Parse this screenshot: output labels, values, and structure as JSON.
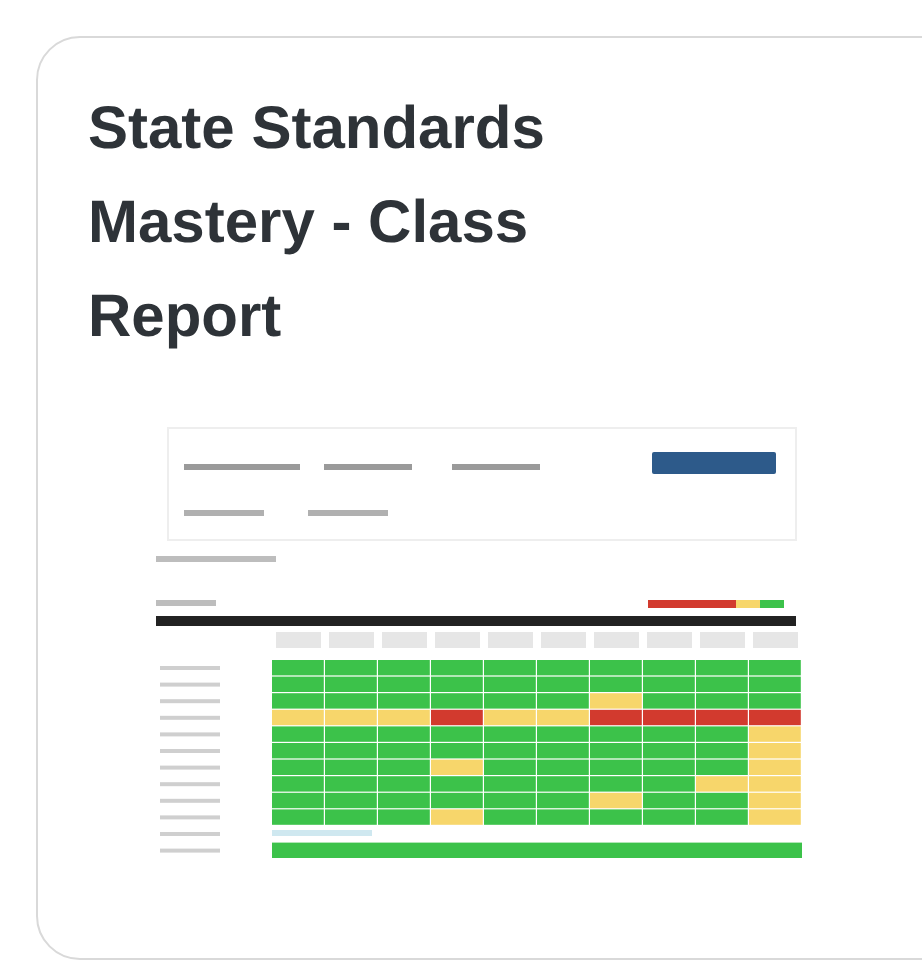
{
  "card": {
    "title": "State Standards Mastery - Class Report"
  }
}
